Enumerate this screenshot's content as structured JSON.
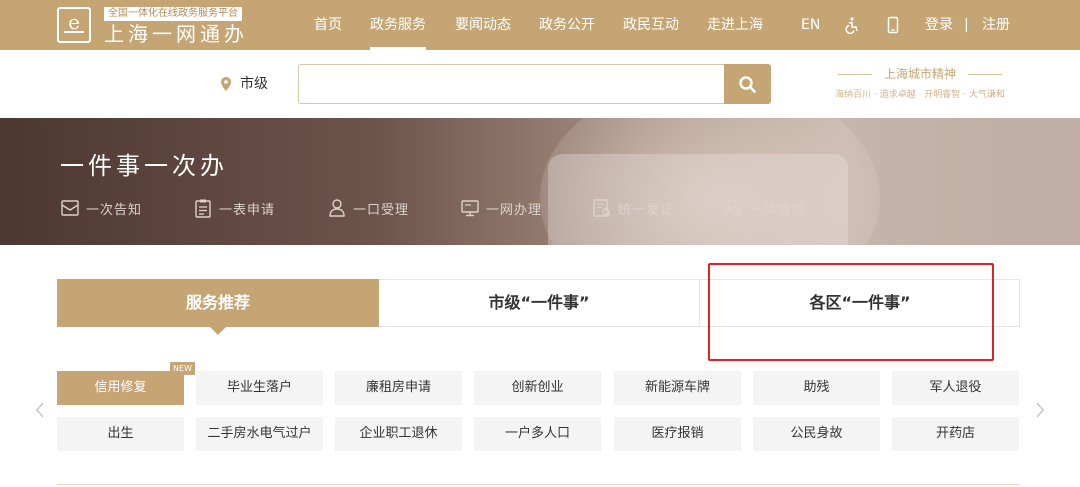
{
  "header": {
    "logo_tag": "全国一体化在线政务服务平台",
    "logo_title": "上海一网通办",
    "nav": [
      {
        "label": "首页"
      },
      {
        "label": "政务服务",
        "active": true
      },
      {
        "label": "要闻动态"
      },
      {
        "label": "政务公开"
      },
      {
        "label": "政民互动"
      },
      {
        "label": "走进上海"
      }
    ],
    "lang": "EN",
    "login": "登录",
    "divider": "|",
    "register": "注册"
  },
  "search": {
    "location": "市级",
    "value": "",
    "placeholder": "",
    "slogan_title": "上海城市精神",
    "slogan_sub": "海纳百川 · 追求卓越 · 开明睿智 · 大气谦和"
  },
  "banner": {
    "title": "一件事一次办",
    "features": [
      {
        "label": "一次告知",
        "icon": "notice-icon"
      },
      {
        "label": "一表申请",
        "icon": "clipboard-icon"
      },
      {
        "label": "一口受理",
        "icon": "user-service-icon"
      },
      {
        "label": "一网办理",
        "icon": "monitor-icon"
      },
      {
        "label": "统一发证",
        "icon": "certificate-icon"
      },
      {
        "label": "一体管理",
        "icon": "user-gear-icon"
      }
    ]
  },
  "tabs": [
    {
      "label": "服务推荐",
      "active": true
    },
    {
      "label": "市级“一件事”"
    },
    {
      "label": "各区“一件事”"
    }
  ],
  "services": {
    "new_badge": "NEW",
    "row1": [
      "信用修复",
      "毕业生落户",
      "廉租房申请",
      "创新创业",
      "新能源车牌",
      "助残",
      "军人退役"
    ],
    "row2": [
      "出生",
      "二手房水电气过户",
      "企业职工退休",
      "一户多人口",
      "医疗报销",
      "公民身故",
      "开药店"
    ]
  },
  "colors": {
    "brand": "#c6a574",
    "highlight": "#e02222"
  }
}
